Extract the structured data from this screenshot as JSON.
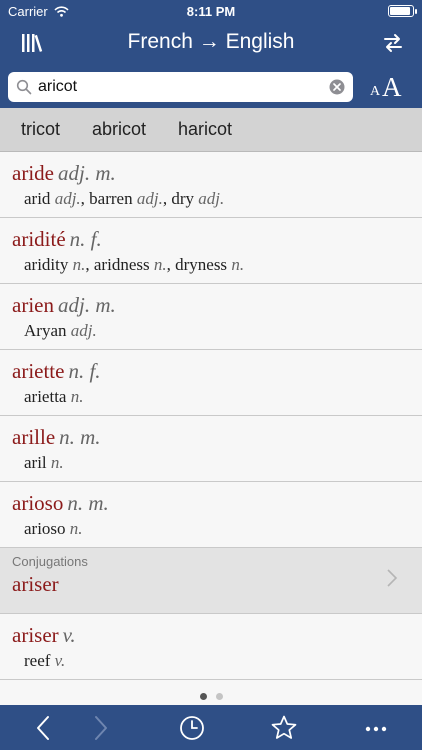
{
  "status": {
    "carrier": "Carrier",
    "time": "8:11 PM"
  },
  "header": {
    "title": "French → English"
  },
  "search": {
    "value": "aricot",
    "font_small": "A",
    "font_large": "A"
  },
  "suggestions": [
    "tricot",
    "abricot",
    "haricot"
  ],
  "entries": [
    {
      "headword": "aride",
      "pos": "adj. m.",
      "translations": [
        {
          "w": "arid",
          "p": "adj."
        },
        {
          "w": "barren",
          "p": "adj."
        },
        {
          "w": "dry",
          "p": "adj."
        }
      ]
    },
    {
      "headword": "aridité",
      "pos": "n. f.",
      "translations": [
        {
          "w": "aridity",
          "p": "n."
        },
        {
          "w": "aridness",
          "p": "n."
        },
        {
          "w": "dryness",
          "p": "n."
        }
      ]
    },
    {
      "headword": "arien",
      "pos": "adj. m.",
      "translations": [
        {
          "w": "Aryan",
          "p": "adj."
        }
      ]
    },
    {
      "headword": "ariette",
      "pos": "n. f.",
      "translations": [
        {
          "w": "arietta",
          "p": "n."
        }
      ]
    },
    {
      "headword": "arille",
      "pos": "n. m.",
      "translations": [
        {
          "w": "aril",
          "p": "n."
        }
      ]
    },
    {
      "headword": "arioso",
      "pos": "n. m.",
      "translations": [
        {
          "w": "arioso",
          "p": "n."
        }
      ]
    }
  ],
  "conjugations": {
    "label": "Conjugations",
    "word": "ariser"
  },
  "entries_after": [
    {
      "headword": "ariser",
      "pos": "v.",
      "translations": [
        {
          "w": "reef",
          "p": "v."
        }
      ]
    }
  ],
  "pager": {
    "pages": 2,
    "active": 0
  },
  "colors": {
    "nav": "#2f4f86",
    "headword": "#8b1a1a"
  },
  "tabbar": {
    "icons": [
      "back-icon",
      "forward-icon",
      "history-icon",
      "favorites-icon",
      "more-icon"
    ]
  }
}
